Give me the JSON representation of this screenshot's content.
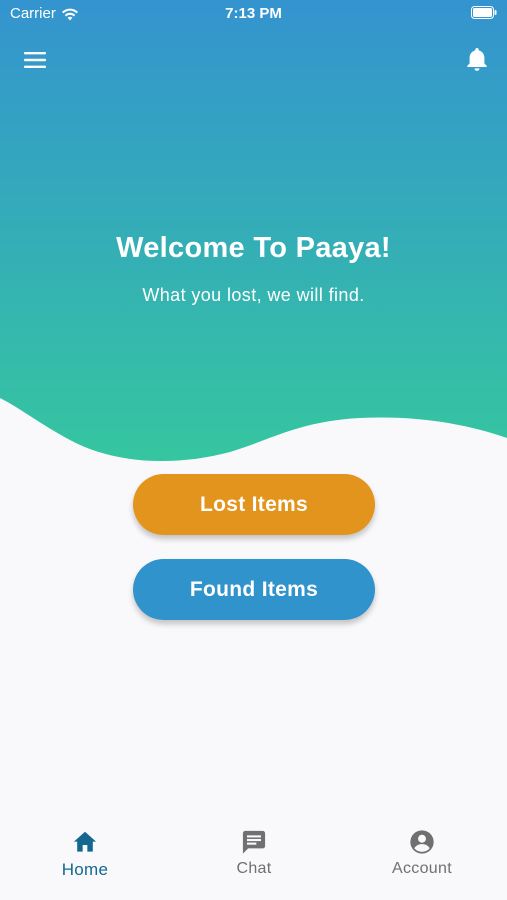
{
  "status_bar": {
    "carrier": "Carrier",
    "time": "7:13 PM"
  },
  "header": {
    "menu_icon": "hamburger-menu-icon",
    "notification_icon": "bell-icon"
  },
  "hero": {
    "title": "Welcome To Paaya!",
    "subtitle": "What you lost, we will find.",
    "gradient_top": "#3494cf",
    "gradient_bottom": "#35c4a0"
  },
  "actions": {
    "lost_label": "Lost Items",
    "found_label": "Found Items",
    "lost_color": "#e3941c",
    "found_color": "#3193cb"
  },
  "bottom_nav": {
    "items": [
      {
        "label": "Home",
        "icon": "home-icon",
        "active": true
      },
      {
        "label": "Chat",
        "icon": "chat-icon",
        "active": false
      },
      {
        "label": "Account",
        "icon": "account-circle-icon",
        "active": false
      }
    ],
    "active_color": "#14688f",
    "inactive_color": "#707070"
  }
}
